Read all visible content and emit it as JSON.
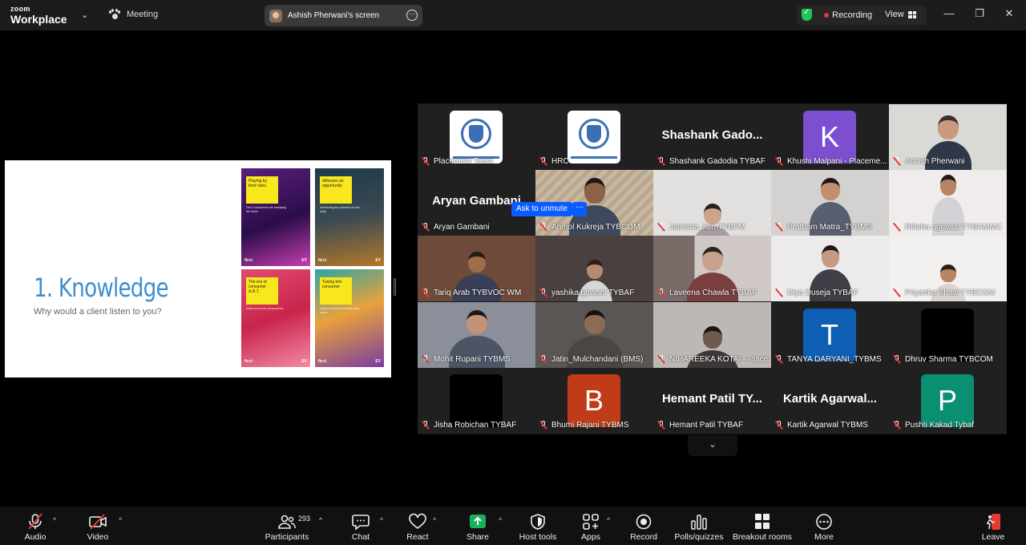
{
  "topbar": {
    "brand_top": "zoom",
    "brand_bottom": "Workplace",
    "meeting_label": "Meeting",
    "screen_share_label": "Ashish Pherwani's screen",
    "recording_label": "Recording",
    "view_label": "View"
  },
  "slide": {
    "title": "1. Knowledge",
    "subtitle": "Why would a client listen to you?",
    "covers": [
      {
        "yellow": "Playing by their rules",
        "text": "Gen Z consumers are reshaping the future",
        "left": "ficci",
        "right": "EY"
      },
      {
        "yellow": "dhlesses an opportunity",
        "text": "Unleashing the potential of rural India",
        "left": "ficci",
        "right": "EY"
      },
      {
        "yellow": "The era of consumer A.R.T.",
        "text": "Indian consumer perspectives",
        "left": "ficci",
        "right": "EY"
      },
      {
        "yellow": "Tuning into consumer",
        "text": "Indian media and entertainment sector",
        "left": "ficci",
        "right": "EY"
      }
    ]
  },
  "participants_tiles": [
    {
      "name": "Placement Team",
      "kind": "logo"
    },
    {
      "name": "HRC",
      "kind": "logo"
    },
    {
      "name": "Shashank Gadodia TYBAF",
      "kind": "text",
      "big": "Shashank  Gado..."
    },
    {
      "name": "Khushi Malpani - Placeme...",
      "kind": "letter",
      "letter": "K",
      "color": "#7b4fd0"
    },
    {
      "name": "Ashish Pherwani",
      "kind": "video",
      "active": true
    },
    {
      "name": "Aryan Gambani",
      "kind": "text",
      "big": "Aryan Gambani"
    },
    {
      "name": "Anmol Kukreja TYBCOM",
      "kind": "video"
    },
    {
      "name": "Jainisha Jain TYBFM",
      "kind": "video"
    },
    {
      "name": "Pratham Matra_TYBMS",
      "kind": "video"
    },
    {
      "name": "Ritisha agrawal TYBAMMC",
      "kind": "video"
    },
    {
      "name": "Tariq Arab TYBVOC WM",
      "kind": "video"
    },
    {
      "name": "yashika gowani TYBAF",
      "kind": "video"
    },
    {
      "name": "Laveena Chawla TYBAF",
      "kind": "video"
    },
    {
      "name": "Diya Duseja TYBAF",
      "kind": "video"
    },
    {
      "name": "Priyanka Shaw TYBCOM",
      "kind": "video"
    },
    {
      "name": "Mohit Rupani TYBMS",
      "kind": "video"
    },
    {
      "name": "Jatin_Mulchandani (BMS)",
      "kind": "video"
    },
    {
      "name": "NIHAREEKA KOTAI - Place...",
      "kind": "video"
    },
    {
      "name": "TANYA DARYANI_TYBMS",
      "kind": "letter",
      "letter": "T",
      "color": "#0e5fb3"
    },
    {
      "name": "Dhruv Sharma TYBCOM",
      "kind": "black"
    },
    {
      "name": "Jisha Robichan TYBAF",
      "kind": "black"
    },
    {
      "name": "Bhumi Rajani TYBMS",
      "kind": "letter",
      "letter": "B",
      "color": "#c23b18"
    },
    {
      "name": "Hemant Patil TYBAF",
      "kind": "text",
      "big": "Hemant  Patil  TY..."
    },
    {
      "name": "Kartik Agarwal TYBMS",
      "kind": "text",
      "big": "Kartik  Agarwal..."
    },
    {
      "name": "Pushti Kakad Tybaf",
      "kind": "letter",
      "letter": "P",
      "color": "#0a8f73"
    }
  ],
  "tile_actions": {
    "ask_to_unmute": "Ask to unmute",
    "more": "···"
  },
  "toolbar": {
    "audio": "Audio",
    "video": "Video",
    "participants": "Participants",
    "participants_count": "293",
    "chat": "Chat",
    "react": "React",
    "share": "Share",
    "host_tools": "Host tools",
    "apps": "Apps",
    "record": "Record",
    "polls": "Polls/quizzes",
    "breakout": "Breakout rooms",
    "more": "More",
    "leave": "Leave"
  },
  "colors": {
    "accent": "#0b5cff",
    "active_speaker": "#22c55e",
    "share_green": "#19b25c",
    "leave_red": "#e53935",
    "slide_title": "#3d8fd1"
  }
}
